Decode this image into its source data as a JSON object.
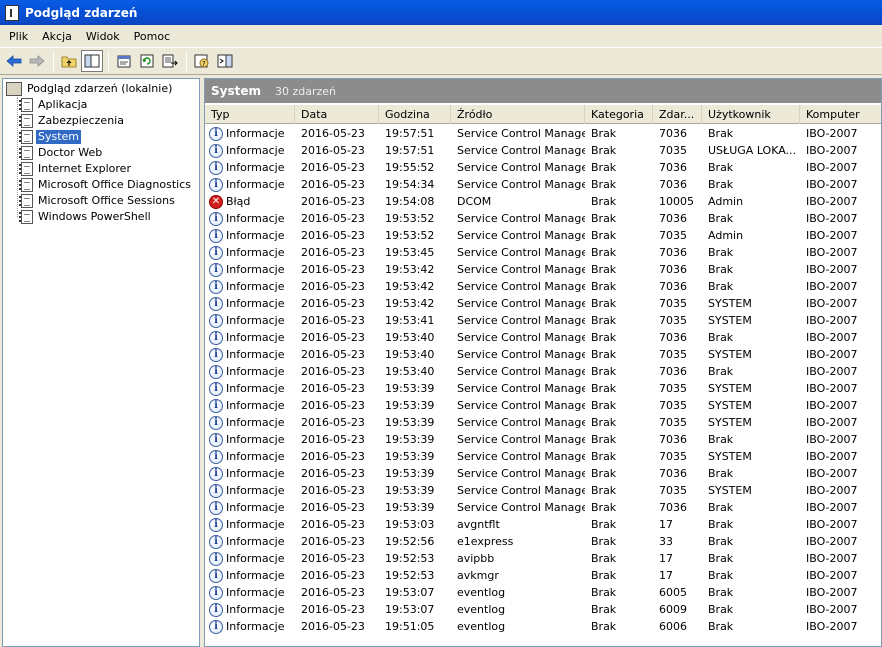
{
  "window": {
    "title": "Podgląd zdarzeń"
  },
  "menu": [
    "Plik",
    "Akcja",
    "Widok",
    "Pomoc"
  ],
  "toolbar": [
    "back-icon",
    "forward-icon",
    "up-folder-icon",
    "show-hide-tree-icon",
    "properties-icon",
    "refresh-icon",
    "export-list-icon",
    "help-icon",
    "console-icon"
  ],
  "tree": {
    "root": "Podgląd zdarzeń (lokalnie)",
    "items": [
      {
        "label": "Aplikacja"
      },
      {
        "label": "Zabezpieczenia"
      },
      {
        "label": "System",
        "selected": true
      },
      {
        "label": "Doctor Web"
      },
      {
        "label": "Internet Explorer"
      },
      {
        "label": "Microsoft Office Diagnostics"
      },
      {
        "label": "Microsoft Office Sessions"
      },
      {
        "label": "Windows PowerShell"
      }
    ]
  },
  "pane": {
    "title": "System",
    "count": "30 zdarzeń"
  },
  "columns": [
    "Typ",
    "Data",
    "Godzina",
    "Źródło",
    "Kategoria",
    "Zdar...",
    "Użytkownik",
    "Komputer"
  ],
  "rows": [
    [
      "info",
      "Informacje",
      "2016-05-23",
      "19:57:51",
      "Service Control Manager",
      "Brak",
      "7036",
      "Brak",
      "IBO-2007"
    ],
    [
      "info",
      "Informacje",
      "2016-05-23",
      "19:57:51",
      "Service Control Manager",
      "Brak",
      "7035",
      "USŁUGA LOKA...",
      "IBO-2007"
    ],
    [
      "info",
      "Informacje",
      "2016-05-23",
      "19:55:52",
      "Service Control Manager",
      "Brak",
      "7036",
      "Brak",
      "IBO-2007"
    ],
    [
      "info",
      "Informacje",
      "2016-05-23",
      "19:54:34",
      "Service Control Manager",
      "Brak",
      "7036",
      "Brak",
      "IBO-2007"
    ],
    [
      "error",
      "Błąd",
      "2016-05-23",
      "19:54:08",
      "DCOM",
      "Brak",
      "10005",
      "Admin",
      "IBO-2007"
    ],
    [
      "info",
      "Informacje",
      "2016-05-23",
      "19:53:52",
      "Service Control Manager",
      "Brak",
      "7036",
      "Brak",
      "IBO-2007"
    ],
    [
      "info",
      "Informacje",
      "2016-05-23",
      "19:53:52",
      "Service Control Manager",
      "Brak",
      "7035",
      "Admin",
      "IBO-2007"
    ],
    [
      "info",
      "Informacje",
      "2016-05-23",
      "19:53:45",
      "Service Control Manager",
      "Brak",
      "7036",
      "Brak",
      "IBO-2007"
    ],
    [
      "info",
      "Informacje",
      "2016-05-23",
      "19:53:42",
      "Service Control Manager",
      "Brak",
      "7036",
      "Brak",
      "IBO-2007"
    ],
    [
      "info",
      "Informacje",
      "2016-05-23",
      "19:53:42",
      "Service Control Manager",
      "Brak",
      "7036",
      "Brak",
      "IBO-2007"
    ],
    [
      "info",
      "Informacje",
      "2016-05-23",
      "19:53:42",
      "Service Control Manager",
      "Brak",
      "7035",
      "SYSTEM",
      "IBO-2007"
    ],
    [
      "info",
      "Informacje",
      "2016-05-23",
      "19:53:41",
      "Service Control Manager",
      "Brak",
      "7035",
      "SYSTEM",
      "IBO-2007"
    ],
    [
      "info",
      "Informacje",
      "2016-05-23",
      "19:53:40",
      "Service Control Manager",
      "Brak",
      "7036",
      "Brak",
      "IBO-2007"
    ],
    [
      "info",
      "Informacje",
      "2016-05-23",
      "19:53:40",
      "Service Control Manager",
      "Brak",
      "7035",
      "SYSTEM",
      "IBO-2007"
    ],
    [
      "info",
      "Informacje",
      "2016-05-23",
      "19:53:40",
      "Service Control Manager",
      "Brak",
      "7036",
      "Brak",
      "IBO-2007"
    ],
    [
      "info",
      "Informacje",
      "2016-05-23",
      "19:53:39",
      "Service Control Manager",
      "Brak",
      "7035",
      "SYSTEM",
      "IBO-2007"
    ],
    [
      "info",
      "Informacje",
      "2016-05-23",
      "19:53:39",
      "Service Control Manager",
      "Brak",
      "7035",
      "SYSTEM",
      "IBO-2007"
    ],
    [
      "info",
      "Informacje",
      "2016-05-23",
      "19:53:39",
      "Service Control Manager",
      "Brak",
      "7035",
      "SYSTEM",
      "IBO-2007"
    ],
    [
      "info",
      "Informacje",
      "2016-05-23",
      "19:53:39",
      "Service Control Manager",
      "Brak",
      "7036",
      "Brak",
      "IBO-2007"
    ],
    [
      "info",
      "Informacje",
      "2016-05-23",
      "19:53:39",
      "Service Control Manager",
      "Brak",
      "7035",
      "SYSTEM",
      "IBO-2007"
    ],
    [
      "info",
      "Informacje",
      "2016-05-23",
      "19:53:39",
      "Service Control Manager",
      "Brak",
      "7036",
      "Brak",
      "IBO-2007"
    ],
    [
      "info",
      "Informacje",
      "2016-05-23",
      "19:53:39",
      "Service Control Manager",
      "Brak",
      "7035",
      "SYSTEM",
      "IBO-2007"
    ],
    [
      "info",
      "Informacje",
      "2016-05-23",
      "19:53:39",
      "Service Control Manager",
      "Brak",
      "7036",
      "Brak",
      "IBO-2007"
    ],
    [
      "info",
      "Informacje",
      "2016-05-23",
      "19:53:03",
      "avgntflt",
      "Brak",
      "17",
      "Brak",
      "IBO-2007"
    ],
    [
      "info",
      "Informacje",
      "2016-05-23",
      "19:52:56",
      "e1express",
      "Brak",
      "33",
      "Brak",
      "IBO-2007"
    ],
    [
      "info",
      "Informacje",
      "2016-05-23",
      "19:52:53",
      "avipbb",
      "Brak",
      "17",
      "Brak",
      "IBO-2007"
    ],
    [
      "info",
      "Informacje",
      "2016-05-23",
      "19:52:53",
      "avkmgr",
      "Brak",
      "17",
      "Brak",
      "IBO-2007"
    ],
    [
      "info",
      "Informacje",
      "2016-05-23",
      "19:53:07",
      "eventlog",
      "Brak",
      "6005",
      "Brak",
      "IBO-2007"
    ],
    [
      "info",
      "Informacje",
      "2016-05-23",
      "19:53:07",
      "eventlog",
      "Brak",
      "6009",
      "Brak",
      "IBO-2007"
    ],
    [
      "info",
      "Informacje",
      "2016-05-23",
      "19:51:05",
      "eventlog",
      "Brak",
      "6006",
      "Brak",
      "IBO-2007"
    ]
  ]
}
